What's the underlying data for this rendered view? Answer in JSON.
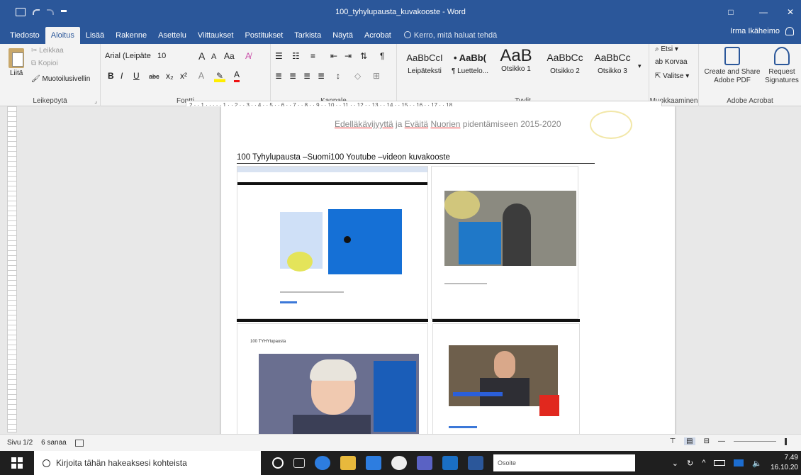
{
  "titlebar": {
    "title": "100_tyhylupausta_kuvakooste - Word",
    "restore": "□",
    "minimize": "—",
    "close": "✕"
  },
  "menu": {
    "tabs": [
      "Tiedosto",
      "Aloitus",
      "Lisää",
      "Rakenne",
      "Asettelu",
      "Viittaukset",
      "Postitukset",
      "Tarkista",
      "Näytä",
      "Acrobat"
    ],
    "active_index": 1,
    "tellme": "Kerro, mitä haluat tehdä",
    "user": "Irma Ikäheimo"
  },
  "ribbon": {
    "clipboard": {
      "paste": "Liitä",
      "cut": "Leikkaa",
      "copy": "Kopioi",
      "format_painter": "Muotoilusivellin",
      "label": "Leikepöytä"
    },
    "font": {
      "name": "Arial (Leipäte",
      "size": "10",
      "grow": "A",
      "shrink": "A",
      "case": "Aa",
      "bold": "B",
      "italic": "I",
      "underline": "U",
      "strike": "abc",
      "subscript": "x₂",
      "superscript": "x²",
      "color": "A",
      "label": "Fontti"
    },
    "paragraph": {
      "label": "Kappale"
    },
    "styles": {
      "items": [
        {
          "sample": "AaBbCcI",
          "name": "Leipäteksti"
        },
        {
          "sample": "• AaBb(",
          "name": "¶ Luettelo..."
        },
        {
          "sample": "AaB",
          "name": "Otsikko 1"
        },
        {
          "sample": "AaBbCc",
          "name": "Otsikko 2"
        },
        {
          "sample": "AaBbCc",
          "name": "Otsikko 3"
        }
      ],
      "label": "Tyylit"
    },
    "editing": {
      "find": "Etsi",
      "replace": "Korvaa",
      "select": "Valitse",
      "label": "Muokkaaminen"
    },
    "acrobat": {
      "create_share_1": "Create and Share",
      "create_share_2": "Adobe PDF",
      "request_1": "Request",
      "request_2": "Signatures",
      "label": "Adobe Acrobat"
    }
  },
  "ruler": {
    "text": "2 · · 1 · · · · · 1 · · 2 · · 3 · · 4 · · 5 · · 6 · · 7 · · 8 · · 9 · · 10 · · 11 · · 12 · · 13 · · 14 · · 15 · · 16 · · 17 · · 18"
  },
  "document": {
    "header_prefix": "",
    "header_ul1": "Edelläkävijyyttä",
    "header_mid": " ja ",
    "header_ul2": "Eväitä",
    "header_ul3": "Nuorien",
    "header_suffix": " pidentämiseen 2015-2020",
    "heading": "100 Tyhylupausta –Suomi100 Youtube –videon kuvakooste",
    "thumb_caption_1": "100 TYHYlupausta"
  },
  "status": {
    "page": "Sivu 1/2",
    "words": "6 sanaa"
  },
  "taskbar": {
    "search_placeholder": "Kirjoita tähän hakeaksesi kohteista",
    "address_label": "Osoite",
    "time": "7.49",
    "date": "16.10.20"
  },
  "colors": {
    "word_blue": "#2b579a",
    "panel_blue": "#1570d6",
    "taskbar": "#1f1f1f"
  }
}
